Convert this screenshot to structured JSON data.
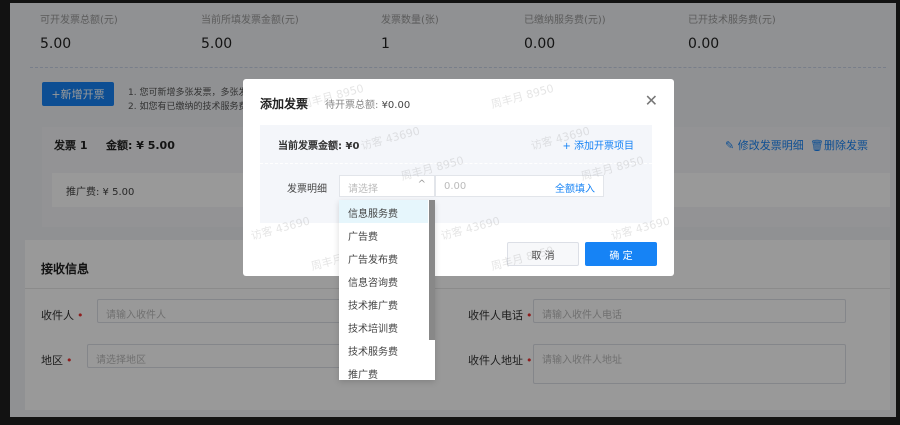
{
  "stats": [
    {
      "label": "可开发票总额(元)",
      "value": "5.00"
    },
    {
      "label": "当前所填发票金额(元)",
      "value": "5.00"
    },
    {
      "label": "发票数量(张)",
      "value": "1"
    },
    {
      "label": "已缴纳服务费(元))",
      "value": "0.00"
    },
    {
      "label": "已开技术服务费(元)",
      "value": "0.00"
    }
  ],
  "add_invoice_button": "+新增开票",
  "notes": [
    "1. 您可新增多张发票，多张发",
    "2. 如您有已缴纳的技术服务费"
  ],
  "invoice": {
    "title": "发票 1",
    "amount": "金额: ¥ 5.00",
    "edit": "修改发票明细",
    "delete": "删除发票",
    "item": "推广费: ¥ 5.00"
  },
  "receive": {
    "title": "接收信息",
    "fields": [
      {
        "label": "收件人",
        "placeholder": "请输入收件人"
      },
      {
        "label": "收件人电话",
        "placeholder": "请输入收件人电话"
      },
      {
        "label": "地区",
        "placeholder": "请选择地区"
      },
      {
        "label": "收件人地址",
        "placeholder": "请输入收件人地址"
      }
    ]
  },
  "modal": {
    "title": "添加发票",
    "subtitle_label": "待开票总额: ",
    "subtitle_value": "¥0.00",
    "current_amount": "当前发票金额: ¥0",
    "add_item": "+ 添加开票项目",
    "detail_label": "发票明细",
    "select_placeholder": "请选择",
    "amount_placeholder": "0.00",
    "fill_all": "全额填入",
    "cancel": "取 消",
    "confirm": "确 定"
  },
  "dropdown_options": [
    "信息服务费",
    "广告费",
    "广告发布费",
    "信息咨询费",
    "技术推广费",
    "技术培训费",
    "技术服务费",
    "推广费"
  ],
  "watermarks": [
    "周丰月 8950",
    "访客 43690"
  ],
  "colors": {
    "accent": "#1683f5",
    "required": "#e33333"
  }
}
